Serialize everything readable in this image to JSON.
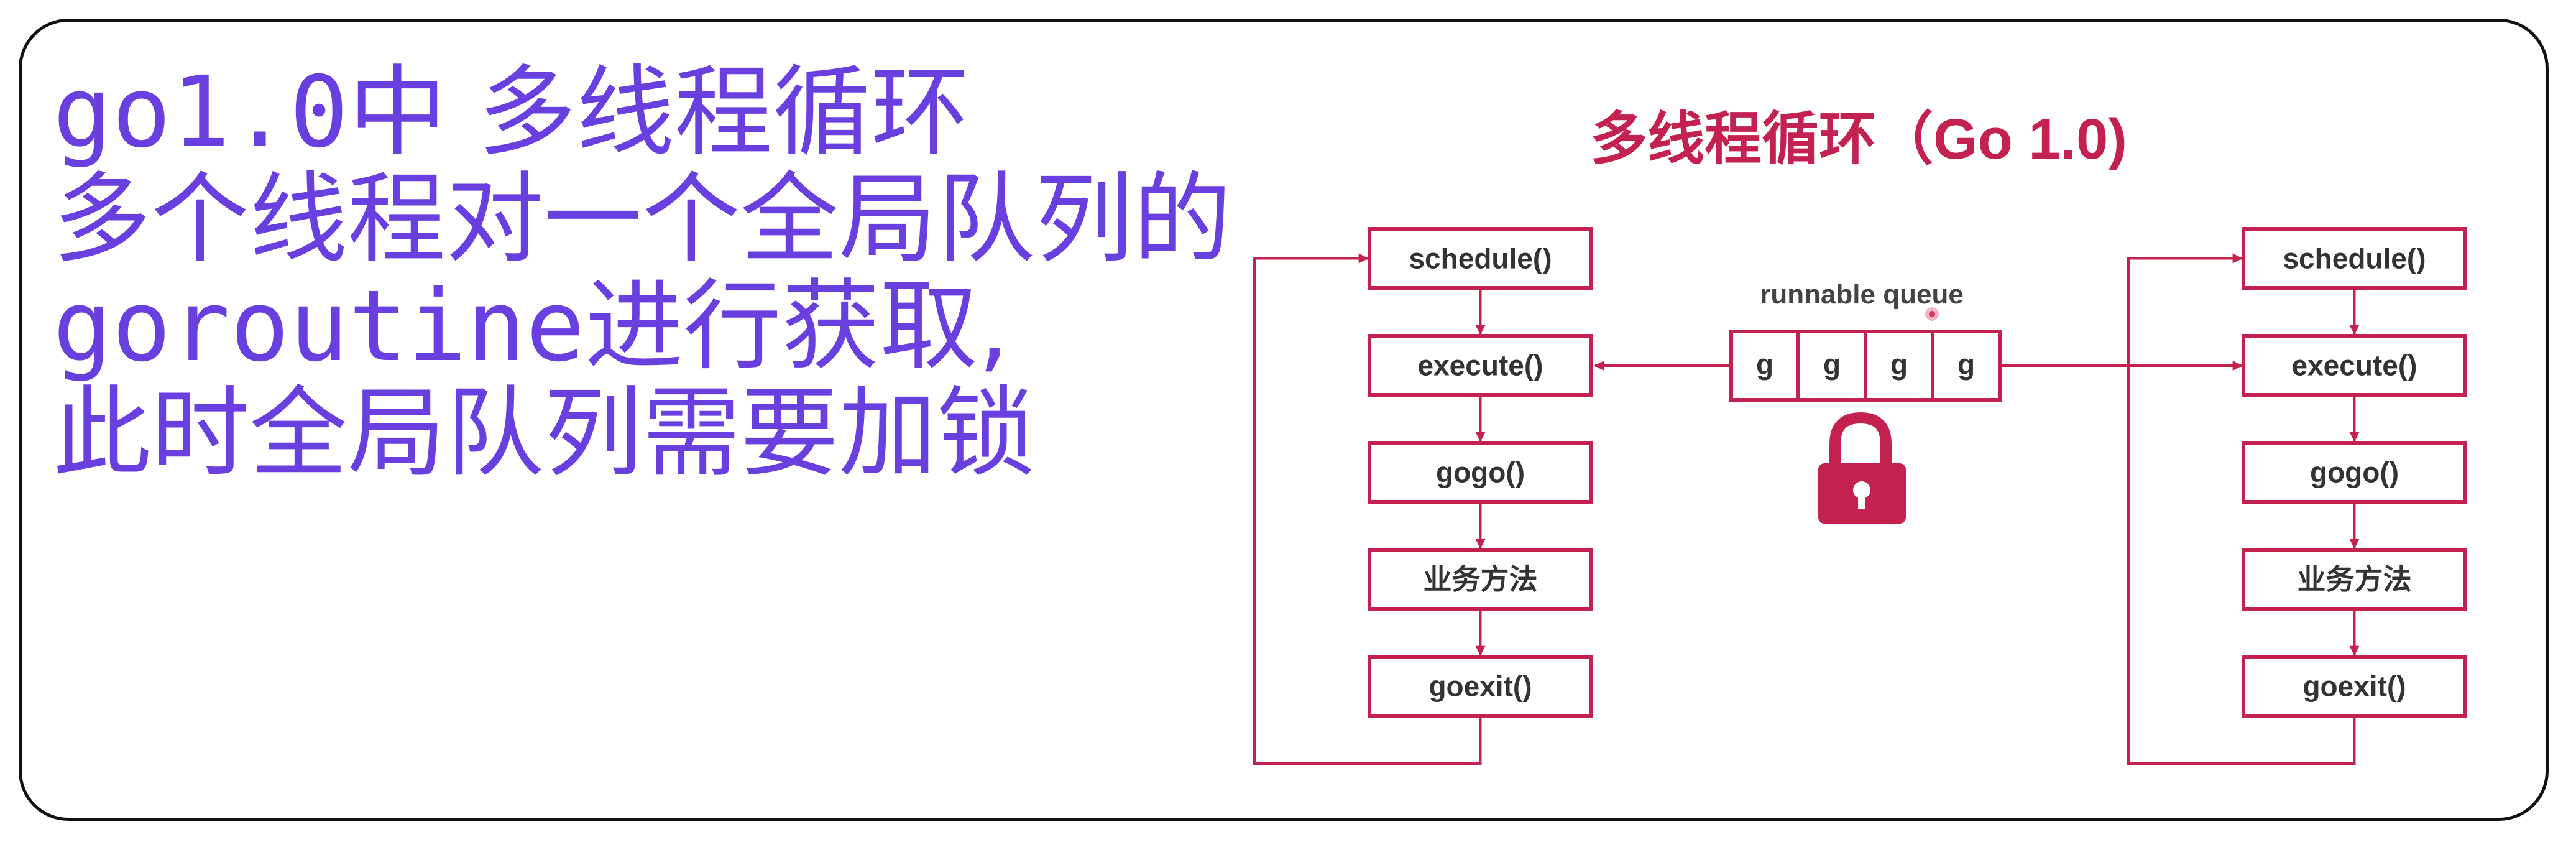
{
  "heading": {
    "line1_prefix": "go1.0",
    "line1_rest": "中 多线程循环",
    "line2": "多个线程对一个全局队列的",
    "line3_prefix": "goroutine",
    "line3_rest": "进行获取,",
    "line4": "此时全局队列需要加锁"
  },
  "diagram": {
    "title": "多线程循环（Go 1.0)",
    "queue_label": "runnable queue",
    "queue_cells": [
      "g",
      "g",
      "g",
      "g"
    ],
    "left_steps": [
      "schedule()",
      "execute()",
      "gogo()",
      "业务方法",
      "goexit()"
    ],
    "right_steps": [
      "schedule()",
      "execute()",
      "gogo()",
      "业务方法",
      "goexit()"
    ],
    "accent_color": "#c3214f",
    "lock_icon": "padlock-icon"
  }
}
